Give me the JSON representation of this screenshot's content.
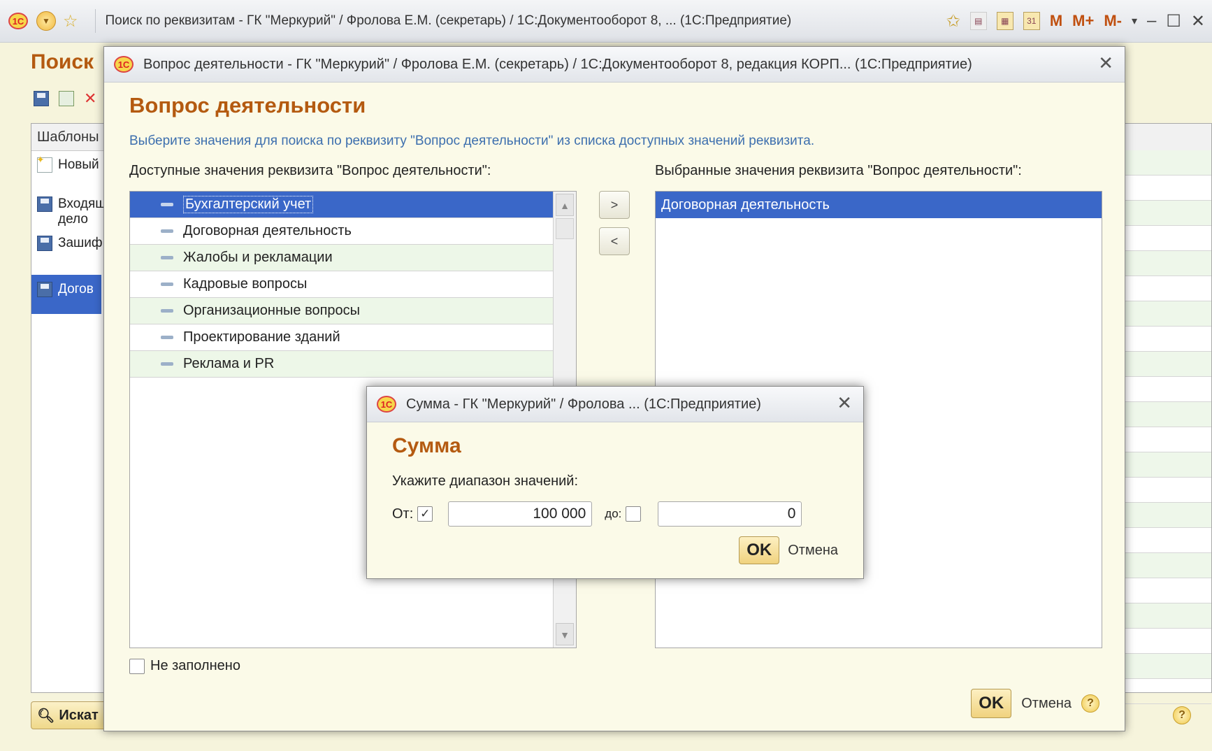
{
  "main_window": {
    "title": "Поиск по реквизитам - ГК \"Меркурий\" / Фролова Е.М. (секретарь) / 1С:Документооборот 8, ... (1С:Предприятие)",
    "logo": "1С",
    "toolbar_icons": [
      "back-icon",
      "favorites-star-icon",
      "bookmark-star-icon",
      "print-icon",
      "calculator-icon",
      "calendar-icon"
    ],
    "calendar_label": "31",
    "m_buttons": [
      "M",
      "M+",
      "M-"
    ]
  },
  "background_form": {
    "title": "Поиск",
    "templates_header": "Шаблоны",
    "templates": [
      {
        "label": "Новый",
        "icon": "new-template-icon"
      },
      {
        "label": "Входящ\nдело",
        "icon": "floppy-icon"
      },
      {
        "label": "Зашиф",
        "icon": "floppy-icon"
      },
      {
        "label": "Догов",
        "icon": "floppy-icon"
      }
    ],
    "search_button": "Искат"
  },
  "activity_dialog": {
    "title": "Вопрос деятельности - ГК \"Меркурий\" / Фролова Е.М. (секретарь) / 1С:Документооборот 8, редакция КОРП... (1С:Предприятие)",
    "heading": "Вопрос деятельности",
    "hint": "Выберите значения для поиска по реквизиту \"Вопрос деятельности\" из списка доступных значений реквизита.",
    "available_label": "Доступные значения реквизита \"Вопрос деятельности\":",
    "chosen_label": "Выбранные значения реквизита \"Вопрос деятельности\":",
    "available_items": [
      "Бухгалтерский учет",
      "Договорная деятельность",
      "Жалобы и рекламации",
      "Кадровые вопросы",
      "Организационные вопросы",
      "Проектирование зданий",
      "Реклама и PR"
    ],
    "chosen_items": [
      "Договорная деятельность"
    ],
    "add_button": ">",
    "remove_button": "<",
    "not_filled_label": "Не заполнено",
    "ok": "OK",
    "cancel": "Отмена"
  },
  "sum_dialog": {
    "title": "Сумма - ГК \"Меркурий\" / Фролова ... (1С:Предприятие)",
    "heading": "Сумма",
    "range_label": "Укажите диапазон значений:",
    "from_label": "От:",
    "from_checked": true,
    "from_value": "100 000",
    "to_label": "до:",
    "to_checked": false,
    "to_value": "0",
    "ok": "OK",
    "cancel": "Отмена"
  },
  "colors": {
    "heading": "#b45a10",
    "selection": "#3a67c8",
    "hint": "#3d6fae",
    "row_alt": "#edf7e8"
  }
}
